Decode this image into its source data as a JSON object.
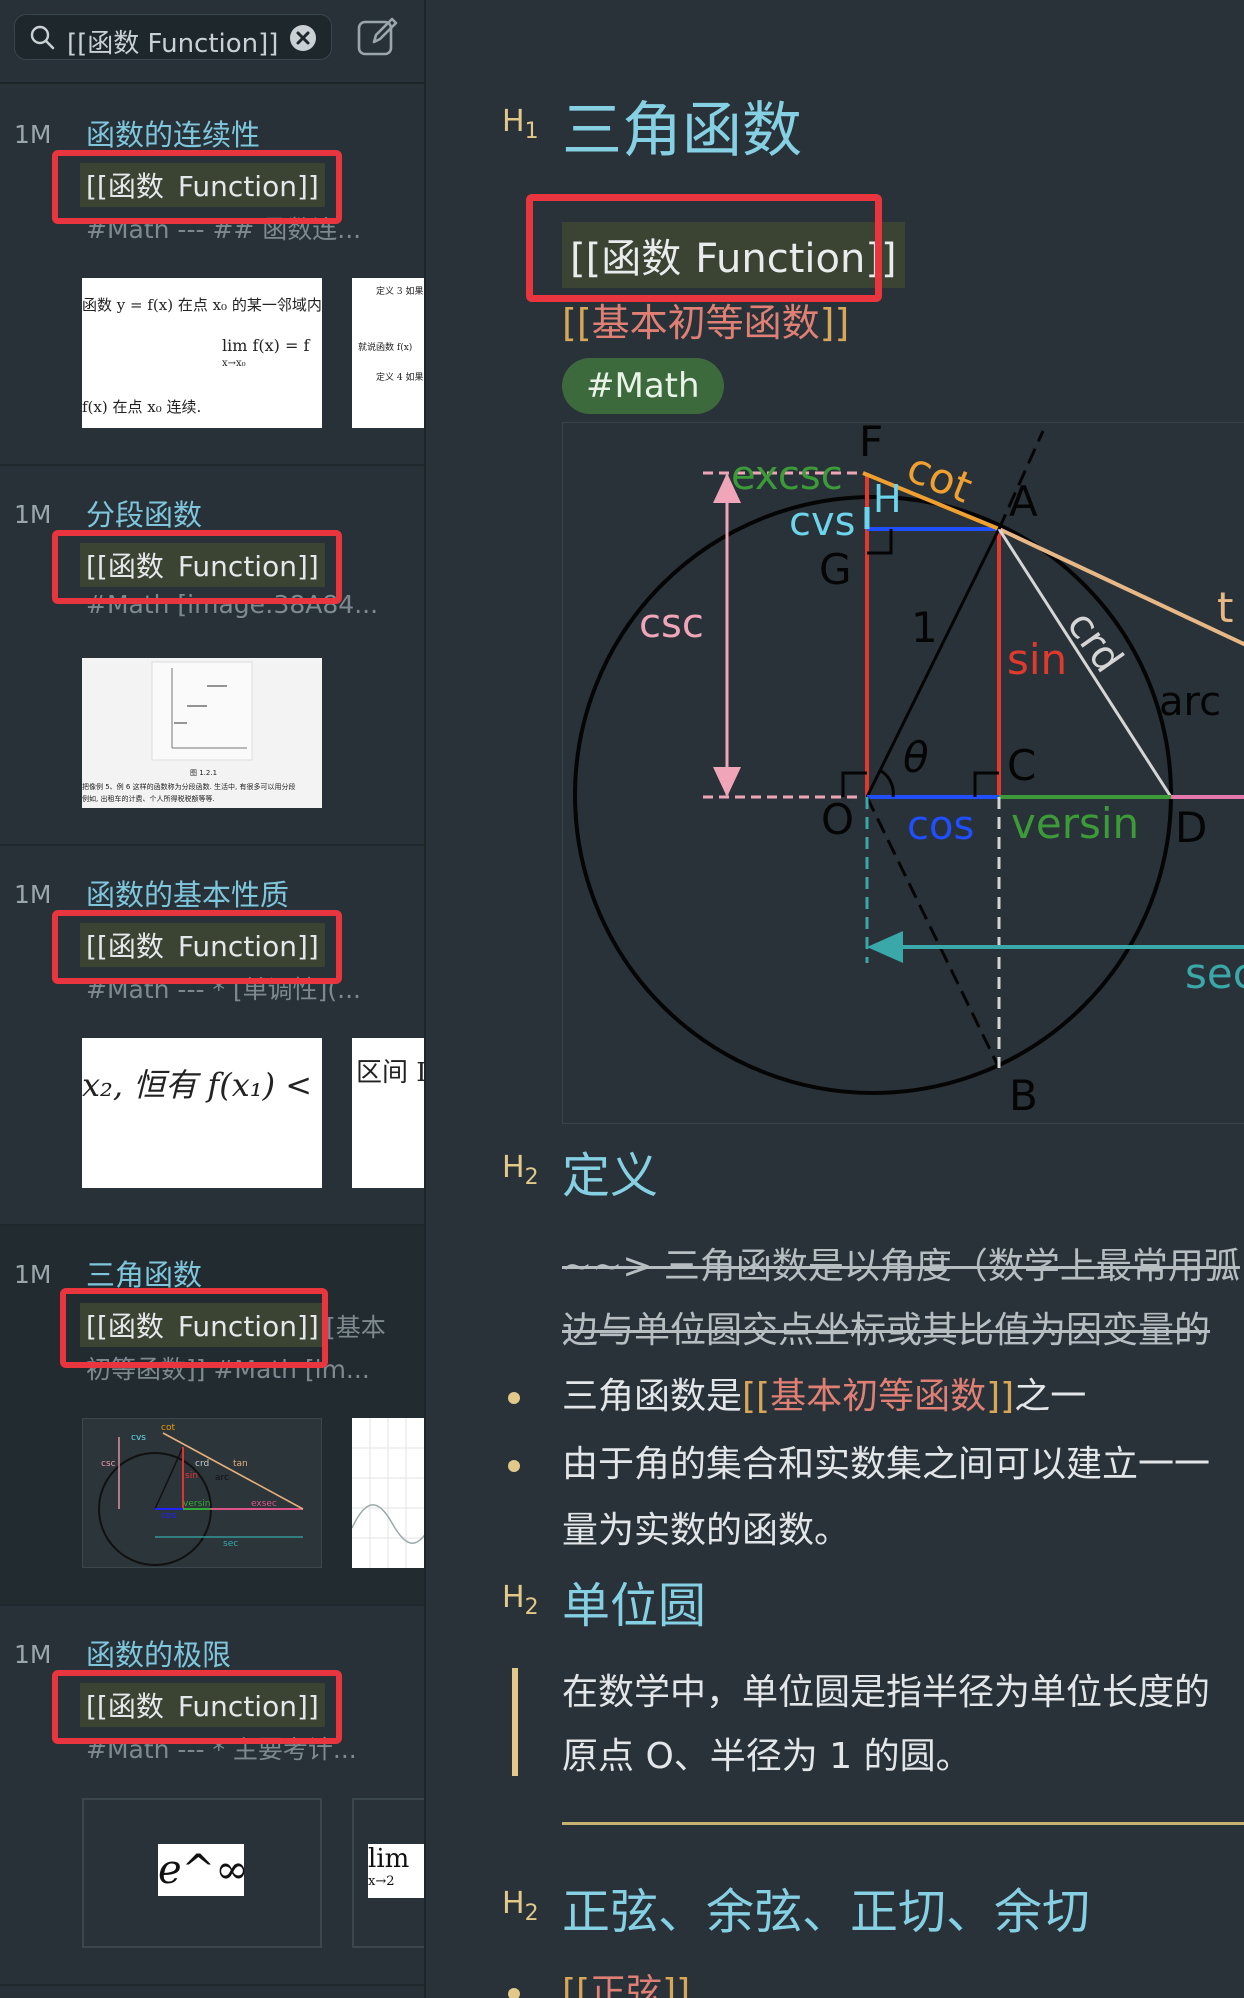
{
  "search": {
    "query": "[[函数 Function]]"
  },
  "notes": [
    {
      "time": "1M",
      "title": "函数的连续性",
      "link_a": "[[函数",
      "link_b": "Function]]",
      "snippet": "#Math --- ## 函数连...",
      "snippet2": ""
    },
    {
      "time": "1M",
      "title": "分段函数",
      "link_a": "[[函数",
      "link_b": "Function]]",
      "snippet": "#Math [image:38A84...",
      "snippet2": ""
    },
    {
      "time": "1M",
      "title": "函数的基本性质",
      "link_a": "[[函数",
      "link_b": "Function]]",
      "snippet": "#Math --- * [单调性](...",
      "snippet2": ""
    },
    {
      "time": "1M",
      "title": "三角函数",
      "link_a": "[[函数",
      "link_b": "Function]]",
      "snippet": "[基本",
      "snippet2": "初等函数]] #Math [im..."
    },
    {
      "time": "1M",
      "title": "函数的极限",
      "link_a": "[[函数",
      "link_b": "Function]]",
      "snippet": "#Math --- * 主要考计...",
      "snippet2": ""
    }
  ],
  "thumbs": {
    "continuity_line1": "函数 y = f(x) 在点 x₀ 的某一邻域内",
    "continuity_line2": "lim f(x) = f",
    "continuity_line2b": "x→x₀",
    "continuity_line3": "f(x) 在点 x₀ 连续.",
    "continuity_side1": "定义 3 如果",
    "continuity_side2": "就说函数 f(x)",
    "continuity_side3": "定义 4 如果",
    "piecewise_caption": "图 1.2.1",
    "piecewise_text": "把像例 5、例 6 这样的函数称为分段函数. 生活中, 有很多可以用分段",
    "piecewise_text2": "例如, 出租车的计费、个人所得税税额等等.",
    "property_text": "x₂, 恒有 f(x₁) <",
    "property_side": "区间 I",
    "trig_labels": [
      "cvs",
      "cot",
      "csc",
      "sin",
      "crd",
      "arc",
      "versin",
      "cos",
      "exsec",
      "sec",
      "tan"
    ],
    "limit_text": "e^∞",
    "limit_side": "lim",
    "limit_side2": "x→2"
  },
  "doc": {
    "h1_mark": "H",
    "h1_num": "1",
    "title": "三角函数",
    "link_a": "[[函数",
    "link_b": "Function]]",
    "link2_open": "[[",
    "link2_text": "基本初等函数",
    "link2_close": "]]",
    "tag": "#Math",
    "diagram_labels": {
      "F": "F",
      "A": "A",
      "H": "H",
      "G": "G",
      "O": "O",
      "C": "C",
      "D": "D",
      "B": "B",
      "cot": "cot",
      "excsc": "excsc",
      "cvs": "cvs",
      "csc": "csc",
      "one": "1",
      "theta": "θ",
      "sin": "sin",
      "crd": "crd",
      "arc": "arc",
      "cos": "cos",
      "versin": "versin",
      "sec": "sec",
      "t": "t"
    },
    "sections": [
      {
        "mark": "H",
        "num": "2",
        "title": "定义"
      },
      {
        "mark": "H",
        "num": "2",
        "title": "单位圆"
      },
      {
        "mark": "H",
        "num": "2",
        "title": "正弦、余弦、正切、余切"
      }
    ],
    "def_strike_line1": "~~> 三角函数是以角度（数学上最常用弧",
    "def_strike_line2": "边与单位圆交点坐标或其比值为因变量的",
    "bullet1_a": "三角函数是",
    "bullet1_open": "[[",
    "bullet1_link": "基本初等函数",
    "bullet1_close": "]]",
    "bullet1_b": "之一",
    "bullet2_line1": "由于角的集合和实数集之间可以建立一一",
    "bullet2_line2": "量为实数的函数。",
    "quote_line1": "在数学中，单位圆是指半径为单位长度的",
    "quote_line2": "原点 O、半径为 1 的圆。",
    "last_bullet_open": "[[",
    "last_bullet_link": "正弦",
    "last_bullet_close": "]]"
  }
}
